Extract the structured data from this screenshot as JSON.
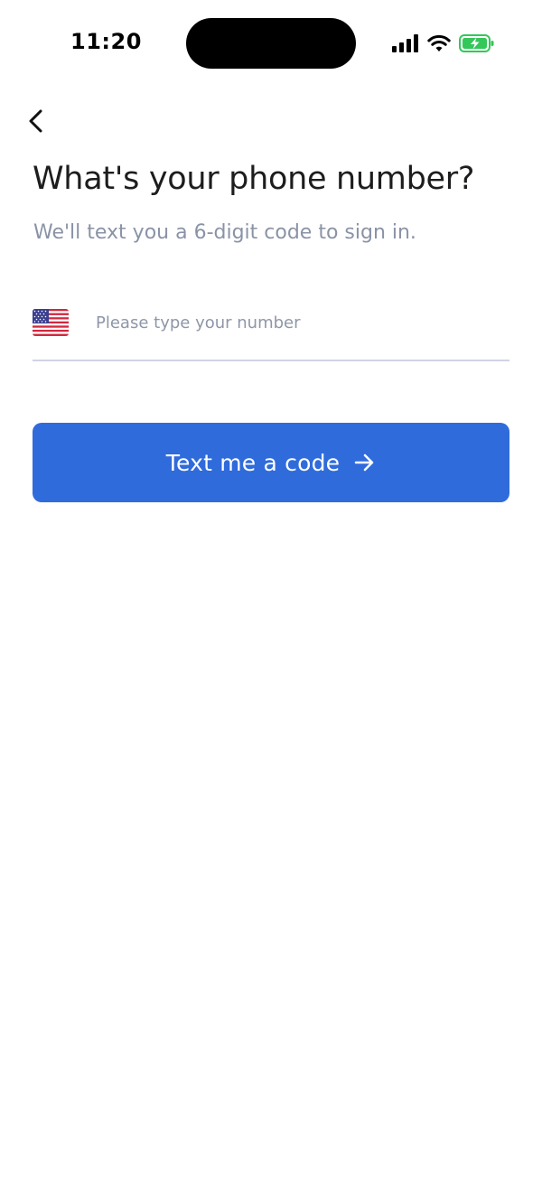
{
  "status_bar": {
    "time": "11:20",
    "icons": [
      "signal-icon",
      "wifi-icon",
      "battery-charging-icon"
    ],
    "battery_color": "#34c759"
  },
  "nav": {
    "back_icon": "chevron-left-icon"
  },
  "content": {
    "title": "What's your phone number?",
    "subtitle": "We'll text you a 6-digit code to sign in."
  },
  "phone_field": {
    "country_flag_icon": "us-flag-icon",
    "value": "",
    "placeholder": "Please type your number"
  },
  "primary_action": {
    "label": "Text me a code",
    "icon": "arrow-right-icon",
    "color": "#2f6bdb"
  }
}
